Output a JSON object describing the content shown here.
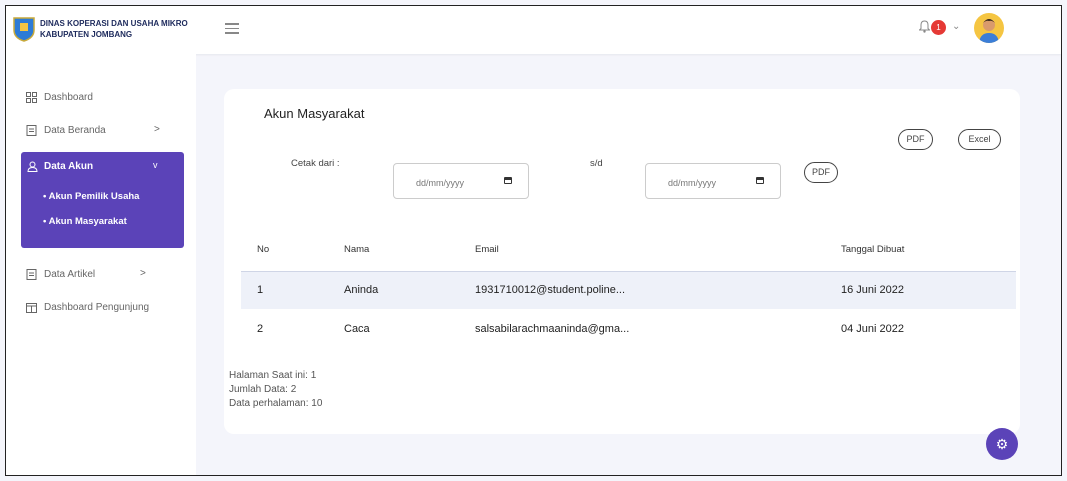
{
  "header": {
    "brand_line1": "DINAS KOPERASI DAN USAHA MIKRO",
    "brand_line2": "KABUPATEN JOMBANG",
    "notification_count": "1",
    "accent_color": "#5b43b8"
  },
  "sidebar": {
    "items": [
      {
        "label": "Dashboard",
        "icon": "grid-icon"
      },
      {
        "label": "Data Beranda",
        "icon": "document-icon",
        "arrow": ">"
      },
      {
        "label": "Data Akun",
        "icon": "user-icon",
        "arrow": "v",
        "active": true,
        "sub": [
          "Akun Pemilik Usaha",
          "Akun Masyarakat"
        ]
      },
      {
        "label": "Data Artikel",
        "icon": "document-icon",
        "arrow": ">"
      },
      {
        "label": "Dashboard Pengunjung",
        "icon": "calendar-icon"
      }
    ]
  },
  "main": {
    "title": "Akun Masyarakat",
    "export_pdf": "PDF",
    "export_excel": "Excel",
    "filter": {
      "label": "Cetak dari :",
      "separator": "s/d",
      "from_placeholder": "dd/mm/yyyy",
      "to_placeholder": "dd/mm/yyyy",
      "button": "PDF"
    },
    "table": {
      "headers": [
        "No",
        "Nama",
        "Email",
        "Tanggal Dibuat"
      ],
      "rows": [
        [
          "1",
          "Aninda",
          "1931710012@student.poline...",
          "16 Juni 2022"
        ],
        [
          "2",
          "Caca",
          "salsabilarachmaaninda@gma...",
          "04 Juni 2022"
        ]
      ]
    },
    "pagination": {
      "current_page": "Halaman Saat ini: 1",
      "total": "Jumlah Data: 2",
      "per_page": "Data perhalaman: 10"
    }
  }
}
